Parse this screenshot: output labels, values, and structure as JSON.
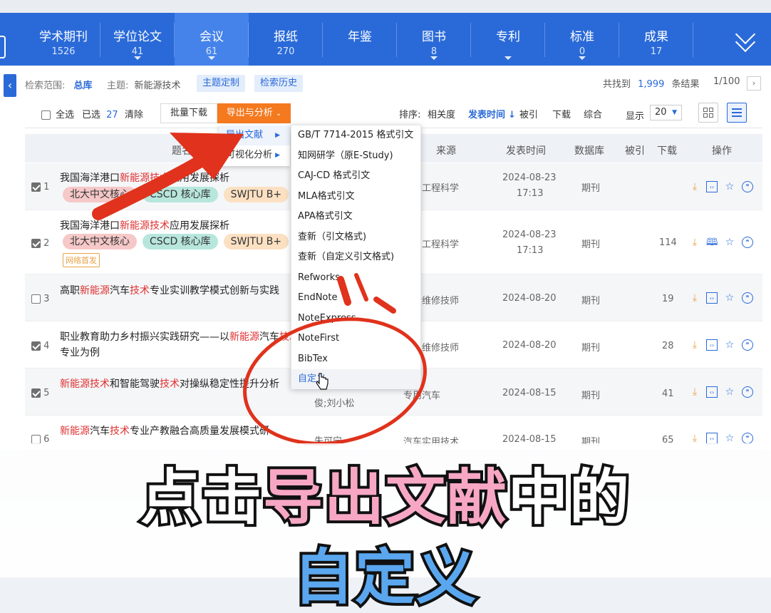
{
  "nav": {
    "items": [
      {
        "label": "学术期刊",
        "count": "1526"
      },
      {
        "label": "学位论文",
        "count": "41"
      },
      {
        "label": "会议",
        "count": "61"
      },
      {
        "label": "报纸",
        "count": "270"
      },
      {
        "label": "年鉴",
        "count": ""
      },
      {
        "label": "图书",
        "count": "8"
      },
      {
        "label": "专利",
        "count": ""
      },
      {
        "label": "标准",
        "count": "0"
      },
      {
        "label": "成果",
        "count": "17"
      }
    ],
    "active_index": 2,
    "expand_icon": "double-chevron-down-icon"
  },
  "scope": {
    "range_label": "检索范围:",
    "range_value": "总库",
    "topic_label": "主题:",
    "topic_value": "新能源技术",
    "btn_custom": "主题定制",
    "btn_history": "检索历史"
  },
  "results": {
    "found_prefix": "共找到",
    "found_count": "1,999",
    "found_suffix": "条结果",
    "page": "1/100",
    "next_icon": "chevron-right-icon"
  },
  "toolbar": {
    "select_all": "全选",
    "selected_label": "已选",
    "selected_count": "27",
    "clear": "清除",
    "batch_download": "批量下载",
    "export_analyze": "导出与分析",
    "sort_label": "排序:",
    "sort_relevance": "相关度",
    "sort_date": "发表时间",
    "sort_cited": "被引",
    "sort_download": "下载",
    "sort_composite": "综合",
    "show_label": "显示",
    "show_value": "20"
  },
  "table": {
    "headers": {
      "title": "题名",
      "source": "来源",
      "date": "发表时间",
      "db": "数据库",
      "cited": "被引",
      "download": "下载",
      "ops": "操作"
    },
    "rows": [
      {
        "num": "1",
        "checked": true,
        "title_html_parts": [
          "我国海洋港口",
          "新能",
          "源技术",
          "应用发展探析"
        ],
        "tags": [
          "北大中文核心",
          "CSCD 核心库",
          "SWJTU B+"
        ],
        "netfirst": "",
        "author": "",
        "source": "工程科学",
        "date": "2024-08-23",
        "time": "17:13",
        "db": "期刊",
        "cited": "",
        "download": ""
      },
      {
        "num": "2",
        "checked": true,
        "title_html_parts": [
          "我国海洋港口",
          "新能源技术",
          "应用发展探析",
          ""
        ],
        "tags": [
          "北大中文核心",
          "CSCD 核心库",
          "SWJTU B+"
        ],
        "netfirst": "网络首发",
        "author": "",
        "source": "工程科学",
        "date": "2024-08-23",
        "time": "17:13",
        "db": "期刊",
        "cited": "",
        "download": "114"
      },
      {
        "num": "3",
        "checked": false,
        "title_html_parts": [
          "高职",
          "新能源",
          "汽车",
          "技术",
          "专业实训教学模式创新与实践"
        ],
        "tags": [],
        "netfirst": "",
        "author": "",
        "source": "维修技师",
        "date": "2024-08-20",
        "time": "",
        "db": "期刊",
        "cited": "",
        "download": "19"
      },
      {
        "num": "4",
        "checked": true,
        "title_html_parts": [
          "职业教育助力乡村振兴实践研究——以",
          "新能源",
          "汽",
          "车",
          "技术",
          "专业为例"
        ],
        "tags": [],
        "netfirst": "",
        "author": "",
        "source": "维修技师",
        "date": "2024-08-20",
        "time": "",
        "db": "期刊",
        "cited": "",
        "download": "28"
      },
      {
        "num": "5",
        "checked": true,
        "title_html_parts": [
          "新能源技术",
          "和智能驾驶",
          "技术",
          "对操纵稳定性提升分析"
        ],
        "tags": [],
        "netfirst": "",
        "author": "俊;刘小松",
        "source": "专用汽车",
        "date": "2024-08-15",
        "time": "",
        "db": "期刊",
        "cited": "",
        "download": "41"
      },
      {
        "num": "6",
        "checked": false,
        "title_html_parts": [
          "新能源",
          "汽车",
          "技术",
          "专业产教融合高质量发展模式研"
        ],
        "tags": [],
        "netfirst": "",
        "author": "朱可宁",
        "source": "汽车实用技术",
        "date": "2024-08-15",
        "time": "",
        "db": "期刊",
        "cited": "",
        "download": "65"
      }
    ]
  },
  "menu_export": {
    "items": [
      {
        "label": "导出文献",
        "selected": true
      },
      {
        "label": "可视化分析",
        "selected": false
      }
    ]
  },
  "menu_formats": {
    "items": [
      "GB/T 7714-2015 格式引文",
      "知网研学（原E-Study)",
      "CAJ-CD 格式引文",
      "MLA格式引文",
      "APA格式引文",
      "查新（引文格式)",
      "查新（自定义引文格式)",
      "Refworks",
      "EndNote",
      "NoteExpress",
      "NoteFirst",
      "BibTex",
      "自定义"
    ]
  },
  "caption": {
    "line1_a": "点击",
    "line1_b": "导出文献",
    "line1_c": "中的",
    "line2": "自定义"
  },
  "colors": {
    "nav_blue": "#2a6ad8",
    "export_orange": "#f4791f",
    "highlight_red": "#e03030",
    "annotation_red": "#e0321c"
  }
}
